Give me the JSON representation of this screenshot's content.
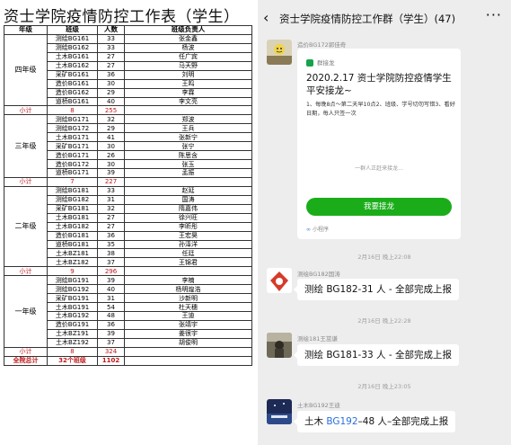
{
  "sheet": {
    "title": "资士学院疫情防控工作表（学生）",
    "headers": [
      "年级",
      "班级",
      "人数",
      "班级负责人"
    ],
    "rows": [
      {
        "grade": "",
        "class": "测绘BG161",
        "count": "33",
        "leader": "张金鑫"
      },
      {
        "grade": "",
        "class": "测绘BG162",
        "count": "33",
        "leader": "杨波"
      },
      {
        "grade": "",
        "class": "土木BG161",
        "count": "27",
        "leader": "任广宾"
      },
      {
        "grade": "四年级",
        "class": "土木BG162",
        "count": "27",
        "leader": "马天野"
      },
      {
        "grade": "",
        "class": "采矿BG161",
        "count": "36",
        "leader": "刘明"
      },
      {
        "grade": "",
        "class": "造价BG161",
        "count": "30",
        "leader": "王鸣"
      },
      {
        "grade": "",
        "class": "造价BG162",
        "count": "29",
        "leader": "李霖"
      },
      {
        "grade": "",
        "class": "道桥BG161",
        "count": "40",
        "leader": "李文亮"
      },
      {
        "type": "subtotal",
        "grade": "小计",
        "class": "8",
        "count": "255",
        "leader": ""
      },
      {
        "grade": "",
        "class": "测绘BG171",
        "count": "32",
        "leader": "郑波"
      },
      {
        "grade": "",
        "class": "测绘BG172",
        "count": "29",
        "leader": "王兵"
      },
      {
        "grade": "",
        "class": "土木BG171",
        "count": "41",
        "leader": "张新宁"
      },
      {
        "grade": "三年级",
        "class": "采矿BG171",
        "count": "30",
        "leader": "张宁"
      },
      {
        "grade": "",
        "class": "造价BG171",
        "count": "26",
        "leader": "陈思含"
      },
      {
        "grade": "",
        "class": "造价BG172",
        "count": "30",
        "leader": "张玉"
      },
      {
        "grade": "",
        "class": "道桥BG171",
        "count": "39",
        "leader": "孟振"
      },
      {
        "type": "subtotal",
        "grade": "小计",
        "class": "7",
        "count": "227",
        "leader": ""
      },
      {
        "grade": "",
        "class": "测绘BG181",
        "count": "33",
        "leader": "赵延"
      },
      {
        "grade": "",
        "class": "测绘BG182",
        "count": "31",
        "leader": "国涛"
      },
      {
        "grade": "",
        "class": "采矿BG181",
        "count": "32",
        "leader": "隋嘉伟"
      },
      {
        "grade": "",
        "class": "土木BG181",
        "count": "27",
        "leader": "徐兴旺"
      },
      {
        "grade": "二年级",
        "class": "土木BG182",
        "count": "27",
        "leader": "李昕彤"
      },
      {
        "grade": "",
        "class": "造价BG181",
        "count": "36",
        "leader": "王宏昊"
      },
      {
        "grade": "",
        "class": "道桥BG181",
        "count": "35",
        "leader": "孙泽洋"
      },
      {
        "grade": "",
        "class": "土木BZ181",
        "count": "38",
        "leader": "任廷"
      },
      {
        "grade": "",
        "class": "土木BZ182",
        "count": "37",
        "leader": "王锦君"
      },
      {
        "type": "subtotal",
        "grade": "小计",
        "class": "9",
        "count": "296",
        "leader": ""
      },
      {
        "grade": "",
        "class": "测绘BG191",
        "count": "39",
        "leader": "李楠"
      },
      {
        "grade": "",
        "class": "测绘BG192",
        "count": "40",
        "leader": "杨明煌浩"
      },
      {
        "grade": "",
        "class": "采矿BG191",
        "count": "31",
        "leader": "沙新明"
      },
      {
        "grade": "一年级",
        "class": "土木BG191",
        "count": "54",
        "leader": "杜天穗"
      },
      {
        "grade": "",
        "class": "土木BG192",
        "count": "48",
        "leader": "王迪"
      },
      {
        "grade": "",
        "class": "造价BG191",
        "count": "36",
        "leader": "张靖宇"
      },
      {
        "grade": "",
        "class": "土木BZ191",
        "count": "39",
        "leader": "姜很宇"
      },
      {
        "grade": "",
        "class": "土木BZ192",
        "count": "37",
        "leader": "胡俊明"
      },
      {
        "type": "subtotal",
        "grade": "小计",
        "class": "8",
        "count": "324",
        "leader": ""
      },
      {
        "type": "total",
        "grade": "全院总计",
        "class": "32个班级",
        "count": "1102",
        "leader": ""
      }
    ]
  },
  "chat": {
    "back_icon": "chevron-left-icon",
    "title": "资士学院疫情防控工作群（学生）(47)",
    "more_icon": "more-icon",
    "card": {
      "sender": "造价BG172郭佳奇",
      "badge": "群接龙",
      "title": "2020.2.17 资士学院防控疫情学生平安接龙~",
      "description": "1、每晚8点～第二天早10点2、班级、学号切勿写错3、看好日期，每人只签一次",
      "waiting": "一群人正赶来接龙...",
      "button": "我要接龙",
      "footer": "小程序"
    },
    "messages": [
      {
        "time": "2月16日 晚上22:08",
        "sender": "测绘BG182国涛",
        "text_pre": "测绘 BG182-31 人 - 全部完成上报",
        "num": ""
      },
      {
        "time": "2月16日 晚上22:28",
        "sender": "测绘181王茁谦",
        "text_pre": "测绘 BG181-33 人 - 全部完成上报",
        "num": ""
      },
      {
        "time": "2月16日 晚上23:05",
        "sender": "土木BG192王迪",
        "text_pre": "土木 ",
        "num": "BG192",
        "text_post": "–48 人–全部完成上报"
      }
    ],
    "colors": {
      "accent_green": "#1aad19",
      "subtotal_red": "#c0171c",
      "link_blue": "#2a6fdb"
    }
  }
}
